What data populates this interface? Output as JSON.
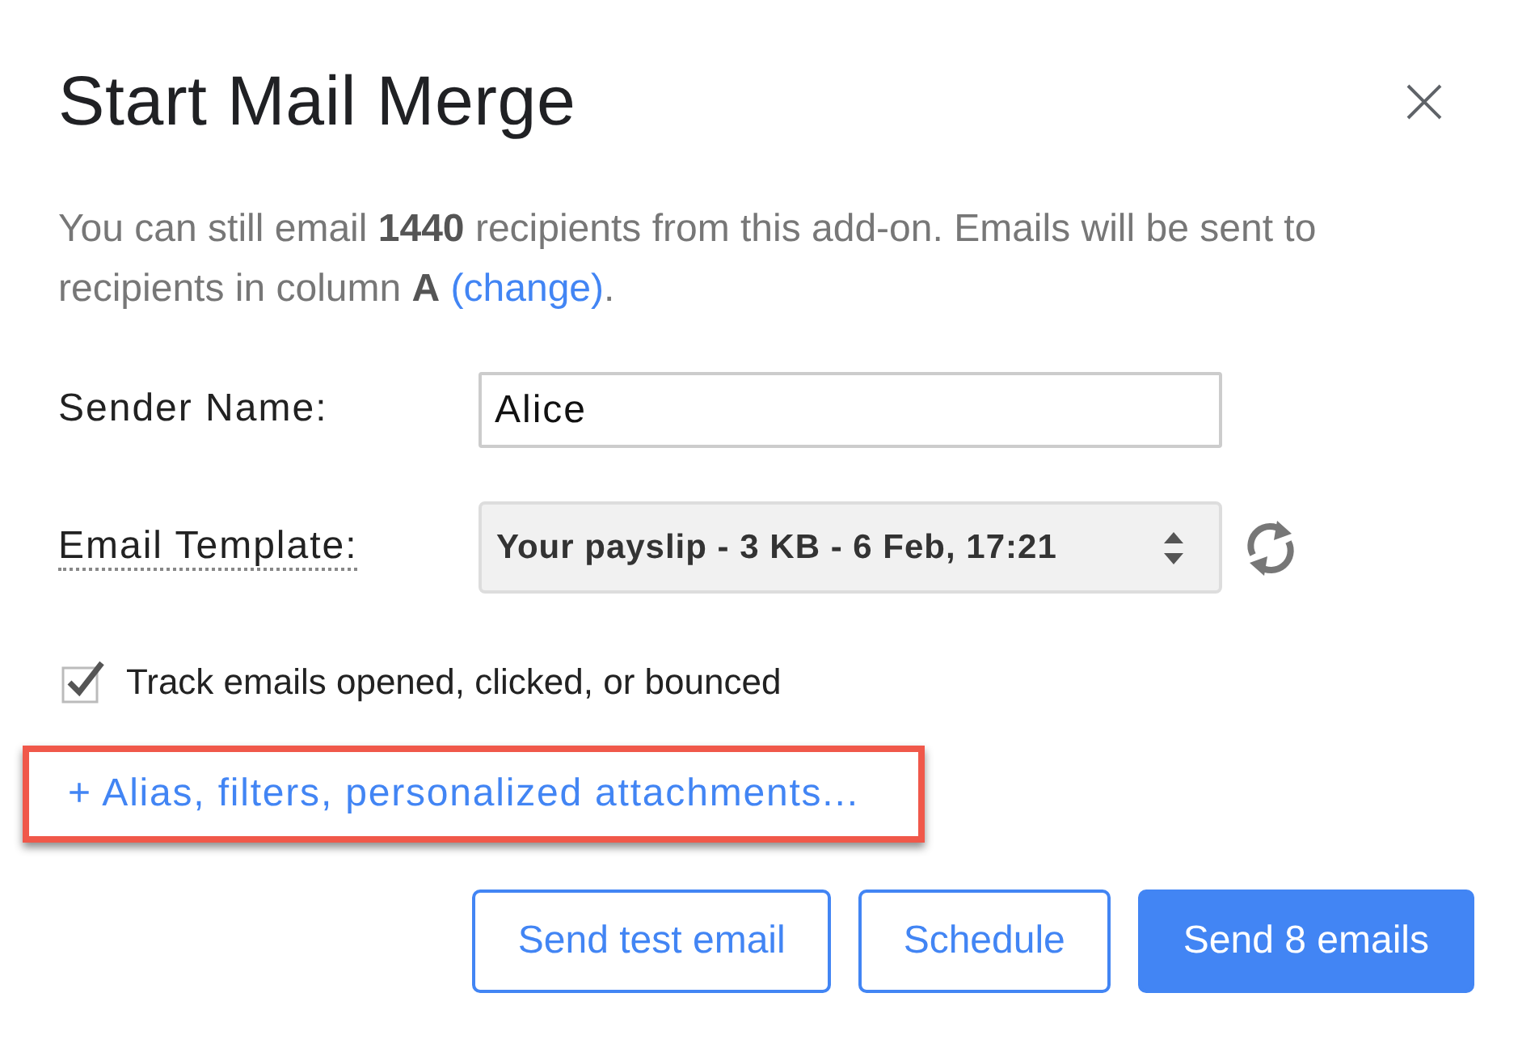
{
  "dialog": {
    "title": "Start Mail Merge"
  },
  "intro": {
    "text": "You can still email **1440** recipients from this add-on. Emails will be sent to recipients in column **A**",
    "link": "(change)",
    "after": "."
  },
  "fields": [
    {
      "kind": "text",
      "label": "Sender Name:",
      "value": "Alice",
      "tooltip": false
    },
    {
      "kind": "select",
      "label": "Email Template:",
      "value": "Your payslip - 3 KB - 6 Feb, 17:21",
      "tooltip": true
    }
  ],
  "tracking": {
    "label": "Track emails opened, clicked, or bounced",
    "checked": true
  },
  "more_link": {
    "text": "+ Alias, filters, personalized attachments...",
    "highlighted": true
  },
  "buttons": [
    {
      "label": "Send test email",
      "kind": "outline"
    },
    {
      "label": "Schedule",
      "kind": "outline"
    },
    {
      "label": "Send 8 emails",
      "kind": "primary"
    }
  ]
}
